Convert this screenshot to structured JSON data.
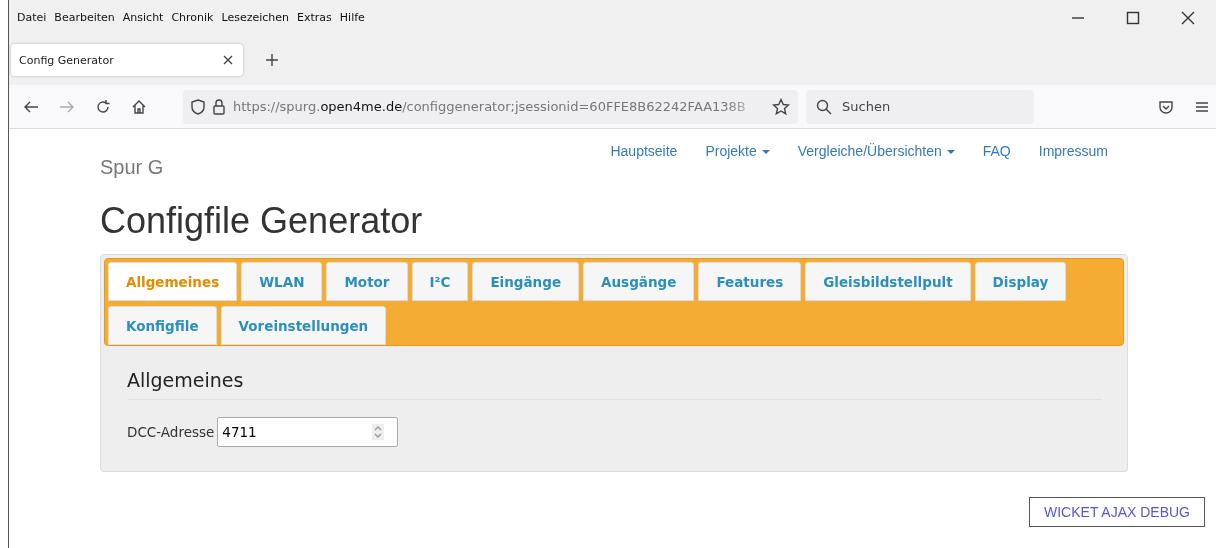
{
  "menu_bar": [
    "Datei",
    "Bearbeiten",
    "Ansicht",
    "Chronik",
    "Lesezeichen",
    "Extras",
    "Hilfe"
  ],
  "browser_tab": {
    "title": "Config Generator",
    "selected": true
  },
  "address_bar": {
    "scheme_host": "https://spurg.",
    "domain": "open4me.de",
    "path": "/configgenerator;jsessionid=60FFE8B62242FAA138B"
  },
  "search_field": {
    "placeholder": "Suchen"
  },
  "site": {
    "brand": "Spur G",
    "nav": [
      {
        "label": "Hauptseite",
        "dropdown": false
      },
      {
        "label": "Projekte",
        "dropdown": true
      },
      {
        "label": "Vergleiche/Übersichten",
        "dropdown": true
      },
      {
        "label": "FAQ",
        "dropdown": false
      },
      {
        "label": "Impressum",
        "dropdown": false
      }
    ]
  },
  "page_title": "Configfile Generator",
  "tabs": [
    {
      "label": "Allgemeines",
      "selected": true
    },
    {
      "label": "WLAN",
      "selected": false
    },
    {
      "label": "Motor",
      "selected": false
    },
    {
      "label": "I²C",
      "selected": false
    },
    {
      "label": "Eingänge",
      "selected": false
    },
    {
      "label": "Ausgänge",
      "selected": false
    },
    {
      "label": "Features",
      "selected": false
    },
    {
      "label": "Gleisbildstellpult",
      "selected": false
    },
    {
      "label": "Display",
      "selected": false
    },
    {
      "label": "Konfigfile",
      "selected": false
    },
    {
      "label": "Voreinstellungen",
      "selected": false
    }
  ],
  "section": {
    "title": "Allgemeines",
    "fields": [
      {
        "label": "DCC-Adresse",
        "value": "4711"
      }
    ]
  },
  "debug_button": "WICKET AJAX DEBUG"
}
